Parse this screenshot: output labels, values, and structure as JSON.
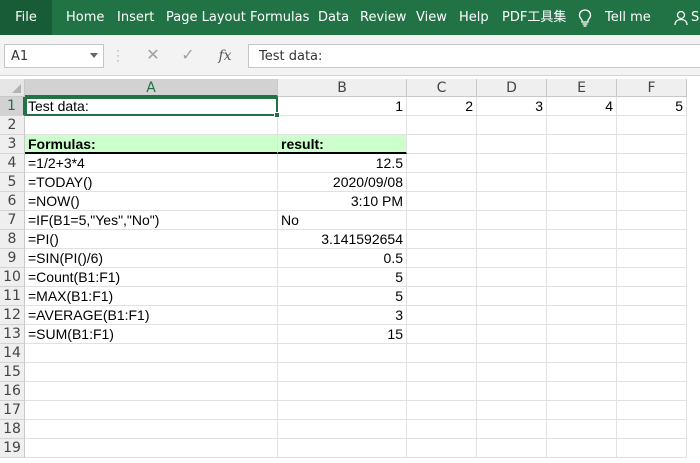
{
  "ribbon": {
    "tabs": [
      "File",
      "Home",
      "Insert",
      "Page Layout",
      "Formulas",
      "Data",
      "Review",
      "View",
      "Help",
      "PDF工具集"
    ],
    "tell_me": "Tell me",
    "user_initial": "S"
  },
  "formula_bar": {
    "name_box": "A1",
    "cancel_glyph": "✕",
    "enter_glyph": "✓",
    "fx_label": "fx",
    "content": "Test data:"
  },
  "columns": [
    "A",
    "B",
    "C",
    "D",
    "E",
    "F"
  ],
  "selected_column": "A",
  "selected_row": 1,
  "rows": [
    {
      "n": 1,
      "A": "Test data:",
      "B": "1",
      "C": "2",
      "D": "3",
      "E": "4",
      "F": "5"
    },
    {
      "n": 2
    },
    {
      "n": 3,
      "A": "Formulas:",
      "B": "result:"
    },
    {
      "n": 4,
      "A": "=1/2+3*4",
      "B": "12.5"
    },
    {
      "n": 5,
      "A": "=TODAY()",
      "B": "2020/09/08"
    },
    {
      "n": 6,
      "A": "=NOW()",
      "B": "3:10 PM"
    },
    {
      "n": 7,
      "A": "=IF(B1=5,\"Yes\",\"No\")",
      "B": "No"
    },
    {
      "n": 8,
      "A": "=PI()",
      "B": "3.141592654"
    },
    {
      "n": 9,
      "A": "=SIN(PI()/6)",
      "B": "0.5"
    },
    {
      "n": 10,
      "A": "=Count(B1:F1)",
      "B": "5"
    },
    {
      "n": 11,
      "A": "=MAX(B1:F1)",
      "B": "5"
    },
    {
      "n": 12,
      "A": "=AVERAGE(B1:F1)",
      "B": "3"
    },
    {
      "n": 13,
      "A": "=SUM(B1:F1)",
      "B": "15"
    },
    {
      "n": 14
    },
    {
      "n": 15
    },
    {
      "n": 16
    },
    {
      "n": 17
    },
    {
      "n": 18
    },
    {
      "n": 19
    }
  ],
  "colors": {
    "ribbon": "#217346",
    "header_fill": "#ccffcc"
  }
}
